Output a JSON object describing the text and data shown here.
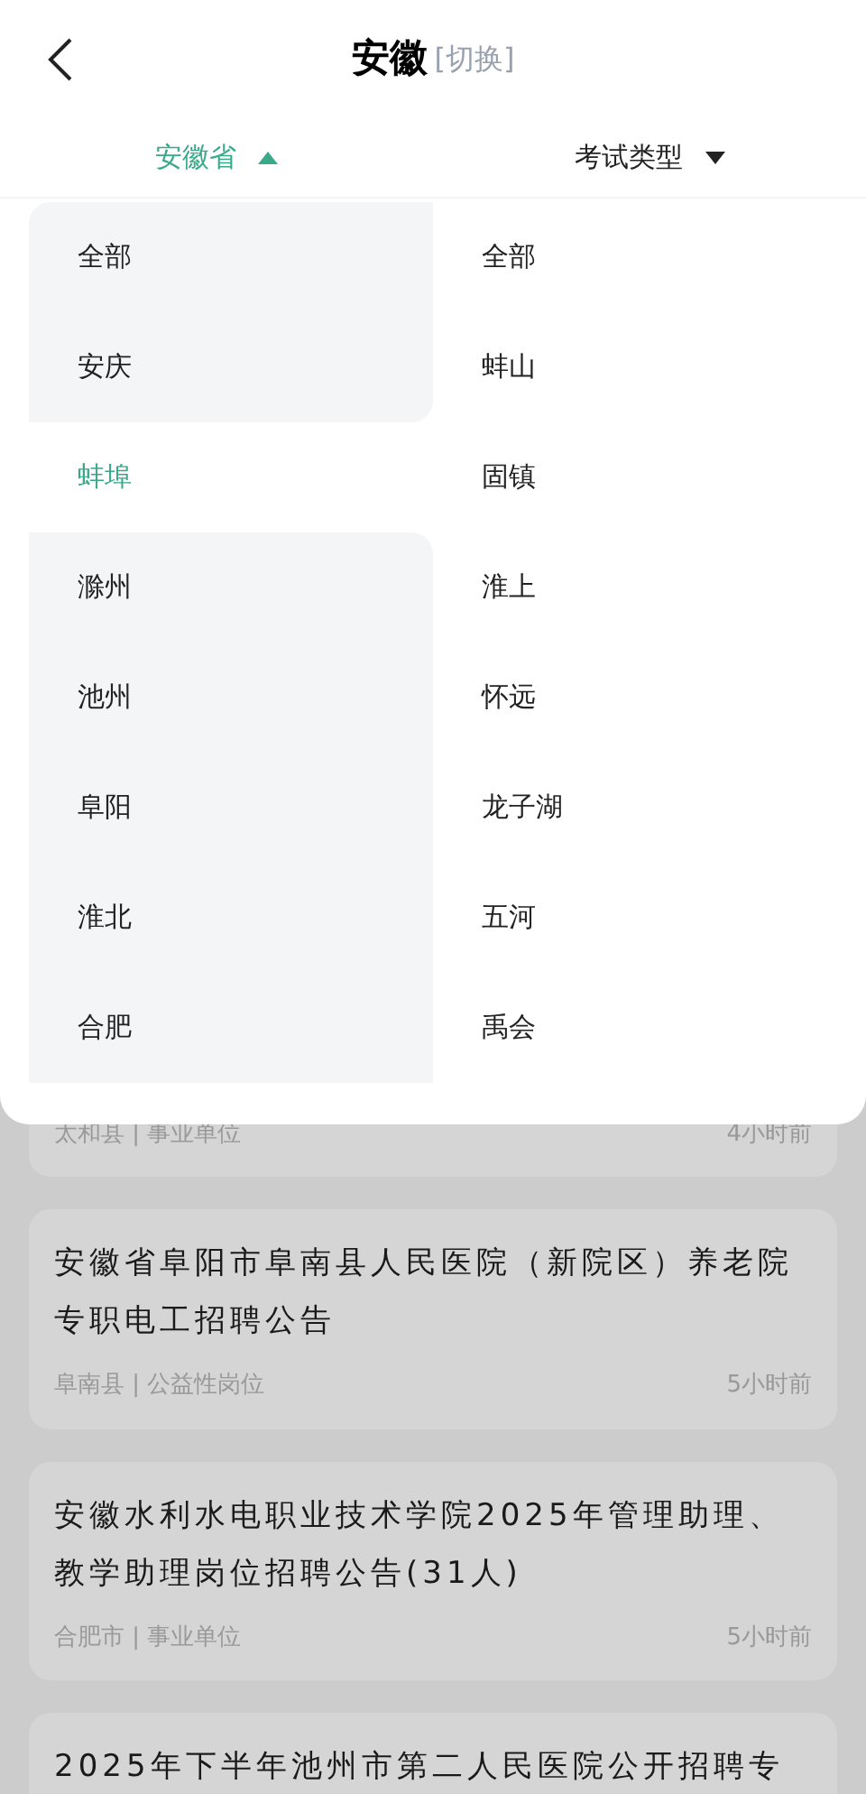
{
  "header": {
    "title": "安徽",
    "switch_label": "[切换]"
  },
  "filters": [
    {
      "label": "安徽省",
      "expanded": true
    },
    {
      "label": "考试类型",
      "expanded": false
    }
  ],
  "dropdown": {
    "cities": [
      {
        "label": "全部",
        "selected": false
      },
      {
        "label": "安庆",
        "selected": false
      },
      {
        "label": "蚌埠",
        "selected": true
      },
      {
        "label": "滁州",
        "selected": false
      },
      {
        "label": "池州",
        "selected": false
      },
      {
        "label": "阜阳",
        "selected": false
      },
      {
        "label": "淮北",
        "selected": false
      },
      {
        "label": "合肥",
        "selected": false
      }
    ],
    "districts": [
      {
        "label": "全部"
      },
      {
        "label": "蚌山"
      },
      {
        "label": "固镇"
      },
      {
        "label": "淮上"
      },
      {
        "label": "怀远"
      },
      {
        "label": "龙子湖"
      },
      {
        "label": "五河"
      },
      {
        "label": "禹会"
      }
    ]
  },
  "jobs": [
    {
      "meta": "太和县 | 事业单位",
      "time": "4小时前"
    },
    {
      "title": "安徽省阜阳市阜南县人民医院（新院区）养老院专职电工招聘公告",
      "meta": "阜南县 | 公益性岗位",
      "time": "5小时前"
    },
    {
      "title": "安徽水利水电职业技术学院2025年管理助理、教学助理岗位招聘公告(31人)",
      "meta": "合肥市 | 事业单位",
      "time": "5小时前"
    },
    {
      "title": "2025年下半年池州市第二人民医院公开招聘专"
    }
  ]
}
